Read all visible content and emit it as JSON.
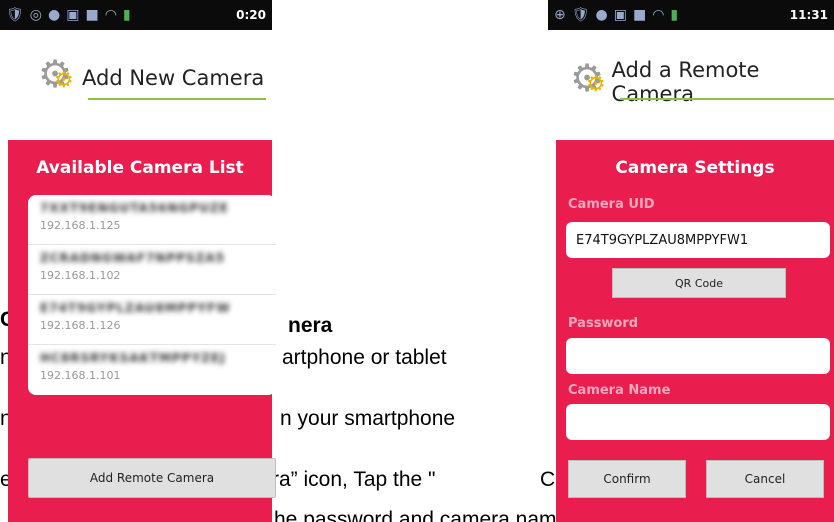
{
  "manual": {
    "heading_left": "C",
    "heading_right": "nera",
    "line1_left": "n",
    "line1_right": "artphone or tablet",
    "line2_left": "n",
    "line2_right": "n your smartphone",
    "line3_left": "e",
    "line3_right": "ra” icon, Tap the \"",
    "line3_tail": "C",
    "line4": "he password and camera name (The default password is"
  },
  "left_phone": {
    "status_time": "0:20",
    "header_title": "Add New Camera",
    "panel_title": "Available Camera List",
    "cameras": [
      {
        "uid": "7XXT9ENGUTA56NGPUZE",
        "ip": "192.168.1.125"
      },
      {
        "uid": "ZCRADNGWAF7NPPSZA5",
        "ip": "192.168.1.102"
      },
      {
        "uid": "E74T9GYPLZAU8MPPYFW",
        "ip": "192.168.1.126"
      },
      {
        "uid": "HC8RSRYKSAKTMPPYZEJ",
        "ip": "192.168.1.101"
      }
    ],
    "add_remote_label": "Add Remote Camera"
  },
  "right_phone": {
    "status_time": "11:31",
    "header_title": "Add a Remote Camera",
    "panel_title": "Camera Settings",
    "uid_label": "Camera UID",
    "uid_value": "E74T9GYPLZAU8MPPYFW1",
    "qr_label": "QR Code",
    "password_label": "Password",
    "password_value": "",
    "name_label": "Camera Name",
    "name_value": "",
    "confirm_label": "Confirm",
    "cancel_label": "Cancel"
  },
  "colors": {
    "panel": "#e91e4f",
    "label": "#f8a8bc",
    "accent_line": "#8bc34a",
    "statusbar": "#0b0b0b"
  }
}
